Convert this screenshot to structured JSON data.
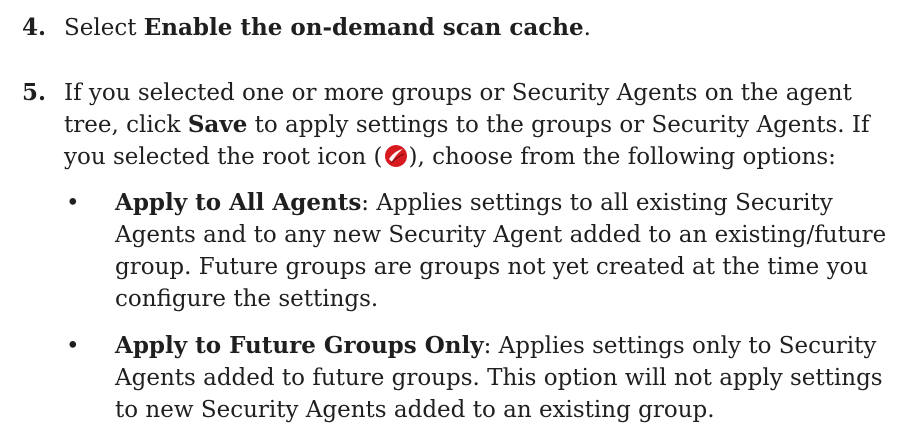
{
  "steps": [
    {
      "number": "4.",
      "pre": "Select ",
      "bold": "Enable the on-demand scan cache",
      "post": "."
    },
    {
      "number": "5.",
      "text_a": "If you selected one or more groups or Security Agents on the agent tree, click ",
      "bold_save": "Save",
      "text_b": " to apply settings to the groups or Security Agents. If you selected the root icon (",
      "icon": "trend-micro-root-icon",
      "text_c": "), choose from the following options:",
      "options": [
        {
          "bullet": "•",
          "title": "Apply to All Agents",
          "description": ": Applies settings to all existing Security Agents and to any new Security Agent added to an existing/future group. Future groups are groups not yet created at the time you configure the settings."
        },
        {
          "bullet": "•",
          "title": "Apply to Future Groups Only",
          "description": ": Applies settings only to Security Agents added to future groups. This option will not apply settings to new Security Agents added to an existing group."
        }
      ]
    }
  ],
  "colors": {
    "text": "#1f1f1f",
    "icon_red": "#d71920"
  }
}
